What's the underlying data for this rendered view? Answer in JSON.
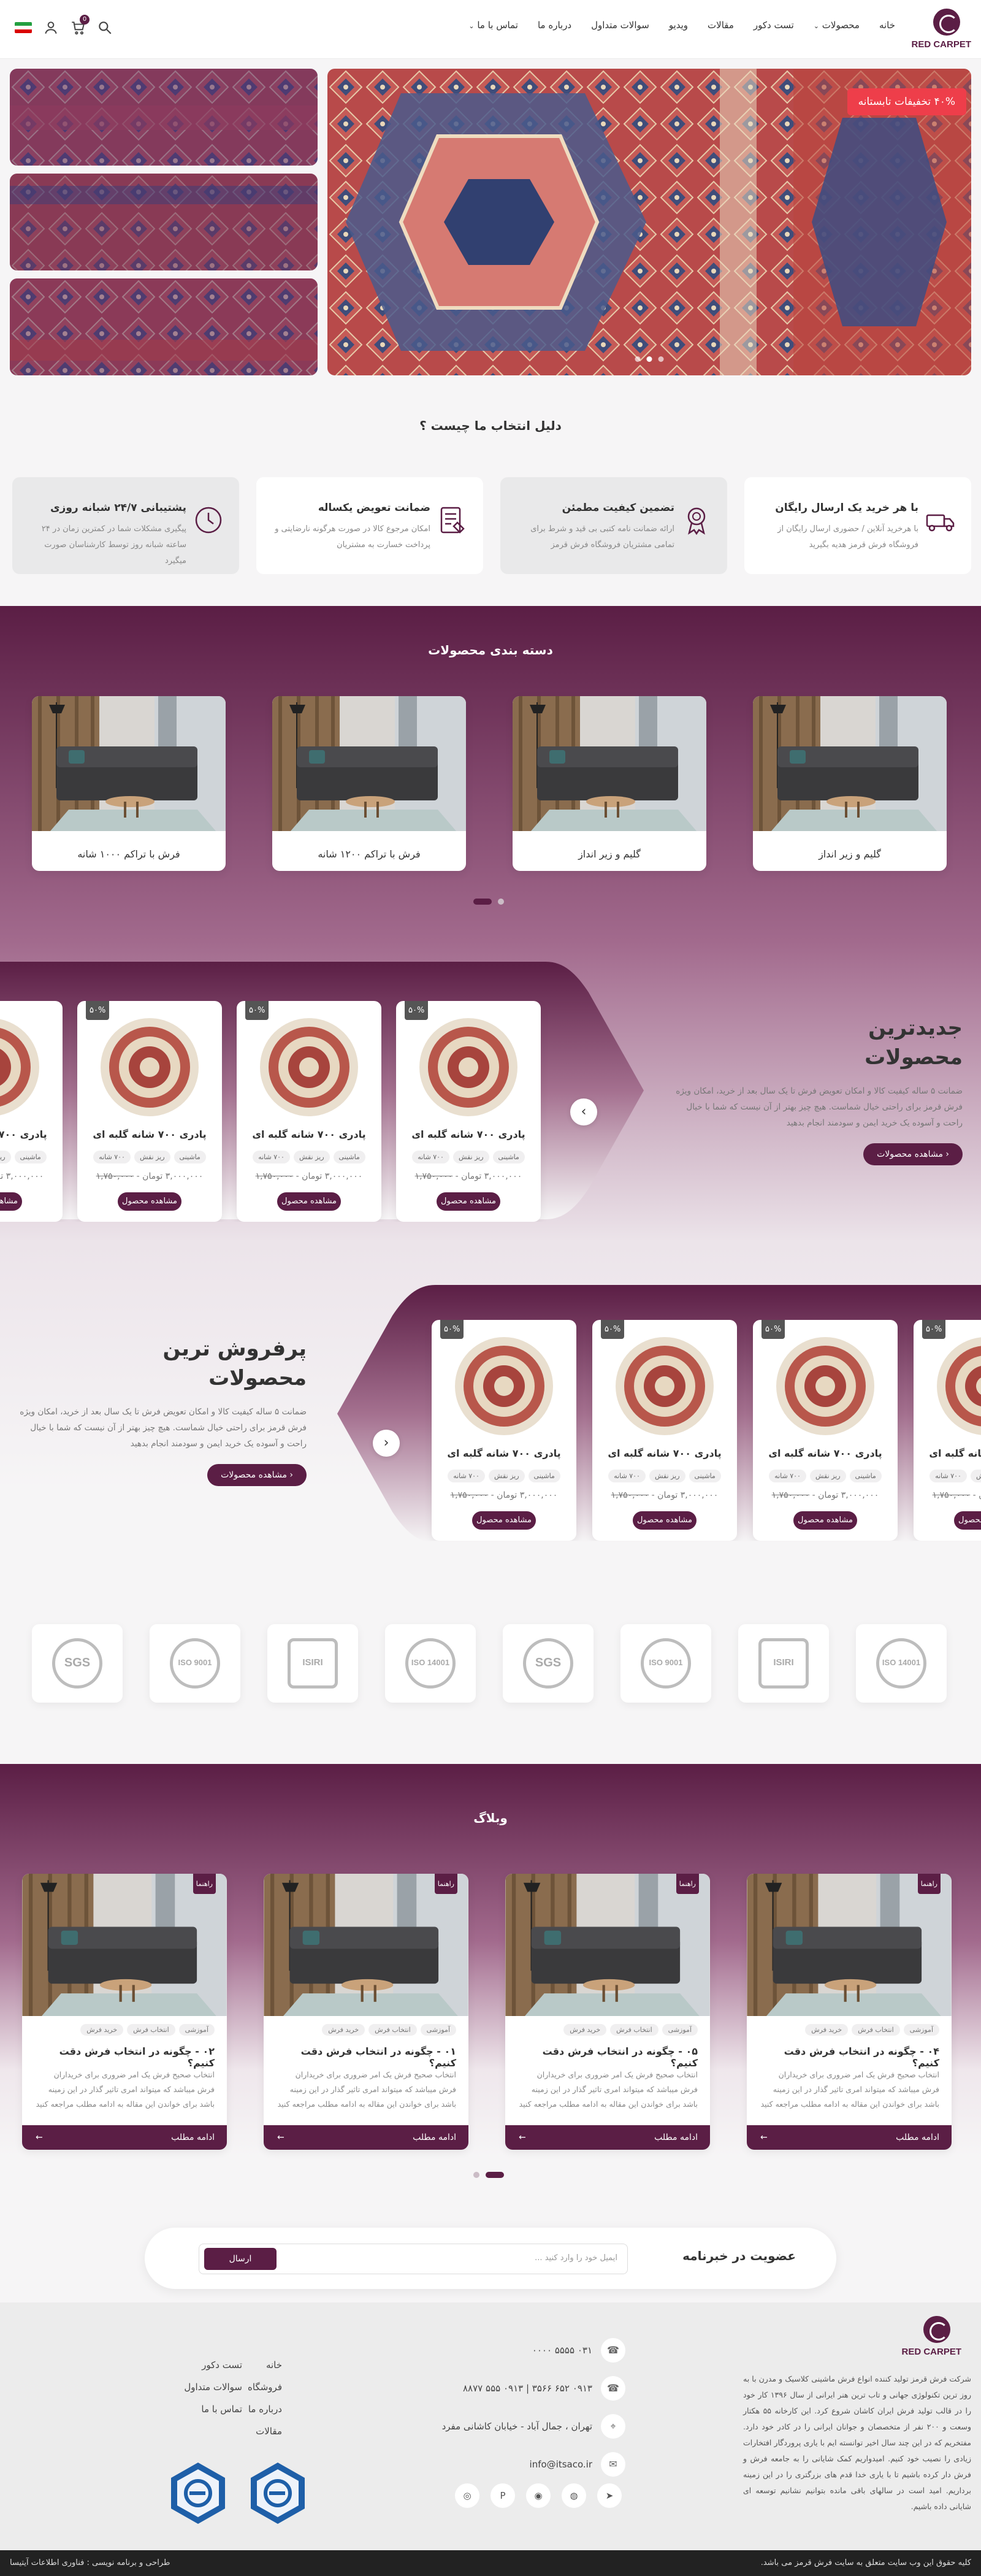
{
  "header": {
    "logo_text": "RED CARPET",
    "nav": [
      "خانه",
      "محصولات",
      "تست دکور",
      "مقالات",
      "ویدیو",
      "سوالات متداول",
      "درباره ما",
      "تماس با ما"
    ],
    "cart_count": "0"
  },
  "hero": {
    "sale_badge": "۴۰% تخفیفات تابستانه"
  },
  "why": {
    "title": "دلیل انتخاب ما چیست ؟",
    "cards": [
      {
        "title": "با هر خرید یک ارسال رایگان",
        "desc": "با هرخرید آنلاین / حضوری ارسال رایگان از فروشگاه فرش قرمز هدیه بگیرید",
        "icon": "free-delivery-icon"
      },
      {
        "title": "تضمین کیفیت مطمئن",
        "desc": "ارائه ضمانت نامه کتبی بی قید و شرط برای تمامی مشتریان فروشگاه فرش قرمز",
        "icon": "quality-badge-icon"
      },
      {
        "title": "ضمانت تعویض یکساله",
        "desc": "امکان مرجوع کالا در صورت هرگونه نارضایتی و پرداخت خسارت به مشتریان",
        "icon": "exchange-guarantee-icon"
      },
      {
        "title": "پشتیبانی ۲۴/۷ شبانه روزی",
        "desc": "پیگیری مشکلات شما در کمترین زمان در ۲۴ ساعته شبانه روز توسط کارشناسان صورت میگیرد",
        "icon": "support-clock-icon"
      }
    ]
  },
  "categories": {
    "title": "دسته بندی محصولات",
    "items": [
      "گلیم و زیر انداز",
      "گلیم و زیر انداز",
      "فرش با تراکم ۱۲۰۰ شانه",
      "فرش با تراکم ۱۰۰۰ شانه"
    ]
  },
  "product": {
    "badge": "۵۰%",
    "title": "پادری ۷۰۰ شانه گلبه ای",
    "tags": [
      "ماشینی",
      "ریز نقش",
      "۷۰۰ شانه"
    ],
    "old_price": "۱,۷۵۰,۰۰۰",
    "price": "۳,۰۰۰,۰۰۰ تومان",
    "button": "مشاهده محصول"
  },
  "newest": {
    "title_line1": "جدیدترین",
    "title_line2": "محصولات",
    "desc": "ضمانت ۵ ساله کیفیت کالا و امکان تعویض فرش تا یک سال بعد از خرید، امکان ویژه فرش قرمز برای راحتی خیال شماست. هیچ چیز بهتر از آن نیست که شما با خیال راحت و آسوده یک خرید ایمن و سودمند انجام بدهید",
    "button": "مشاهده محصولات"
  },
  "bestseller": {
    "title_line1": "پرفروش ترین",
    "title_line2": "محصولات",
    "desc": "ضمانت ۵ ساله کیفیت کالا و امکان تعویض فرش تا یک سال بعد از خرید، امکان ویژه فرش قرمز برای راحتی خیال شماست. هیچ چیز بهتر از آن نیست که شما با خیال راحت و آسوده یک خرید ایمن و سودمند انجام بدهید",
    "button": "مشاهده محصولات"
  },
  "certificates": [
    "ISO 14001",
    "ISIRI",
    "ISO 9001",
    "SGS",
    "ISO 14001",
    "ISIRI",
    "ISO 9001",
    "SGS"
  ],
  "blog": {
    "title": "وبلاگ",
    "tag": "راهنما",
    "tags": [
      "آموزشی",
      "انتخاب فرش",
      "خرید فرش"
    ],
    "desc": "انتخاب صحیح فرش یک امر ضروری برای خریداران فرش میباشد که میتواند امری تاثیر گذار در این زمینه باشد برای خواندن این مقاله به ادامه مطلب مراجعه کنید",
    "button": "ادامه مطلب",
    "posts": [
      "۰۴ - چگونه در انتخاب فرش دقت کنیم؟",
      "۰۵ - چگونه در انتخاب فرش دقت کنیم؟",
      "۰۱ - چگونه در انتخاب فرش دقت کنیم؟",
      "۰۲ - چگونه در انتخاب فرش دقت کنیم؟"
    ]
  },
  "newsletter": {
    "title": "عضویت در خبرنامه",
    "placeholder": "ایمیل خود را وارد کنید ...",
    "button": "ارسال"
  },
  "footer": {
    "about": "شرکت فرش قرمز تولید کننده انواع فرش ماشینی کلاسیک و مدرن با به روز ترین تکنولوژی جهانی و تاب ترین هنر ایرانی از سال ۱۳۹۶ کار خود را در قالب تولید فرش ایران کاشان شروع کرد. این کارخانه ۵۵ هکتار وسعت و ۲۰۰ نفر از متخصصان و جوانان ایرانی را در کادر خود دارد. مفتخریم که در این چند سال اخیر توانسته ایم با یاری پروردگار افتخارات زیادی را نصیب خود کنیم. امیدواریم کمک شایانی را به جامعه فرش و فرش دار کرده باشیم تا با یاری خدا قدم های بزرگتری را در این زمینه برداریم. امید است در سالهای باقی مانده بتوانیم نشانیم توسعه ای شایانی داده باشیم.",
    "phone1": "۰۳۱ ۵۵۵۵ ۰۰۰۰",
    "phone2": "۰۹۱۳ ۶۵۲ ۳۵۶۶ | ۰۹۱۳ ۵۵۵ ۸۸۷۷",
    "address": "تهران ، جمال آباد - خیابان کاشانی مفرد",
    "email": "info@itsaco.ir",
    "links_col1": [
      "خانه",
      "فروشگاه",
      "درباره ما",
      "مقالات"
    ],
    "links_col2": [
      "تست دکور",
      "سوالات متداول",
      "تماس با ما"
    ],
    "copyright": "کلیه حقوق این وب سایت متعلق به سایت فرش قرمز می باشد.",
    "credit": "طراحی و برنامه نویسی : فناوری اطلاعات آیتیسا"
  }
}
